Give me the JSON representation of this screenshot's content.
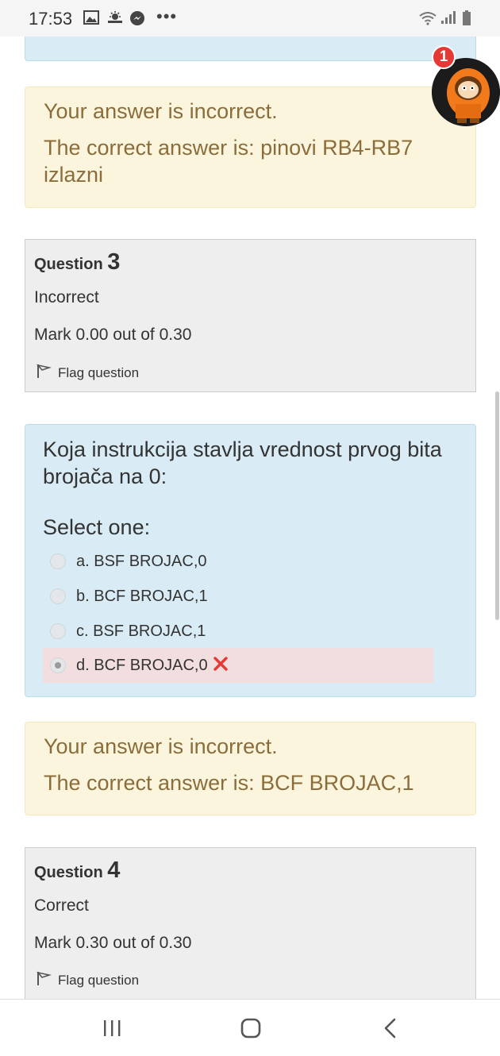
{
  "status_bar": {
    "time": "17:53",
    "icons": [
      "image-icon",
      "weather-icon",
      "messenger-icon",
      "more-dots-icon",
      "wifi-icon",
      "signal-icon",
      "battery-icon"
    ],
    "more_label": "•••"
  },
  "chat_head": {
    "badge_count": "1"
  },
  "feedback_1": {
    "line1": "Your answer is incorrect.",
    "line2": "The correct answer is: pinovi RB4-RB7",
    "line3": "izlazni"
  },
  "question_3": {
    "label": "Question",
    "number": "3",
    "state": "Incorrect",
    "mark": "Mark 0.00 out of 0.30",
    "flag": "Flag question",
    "text": "Koja instrukcija stavlja vrednost prvog bita brojača na 0:",
    "prompt": "Select one:",
    "options": [
      {
        "label": "a. BSF BROJAC,0",
        "selected": false
      },
      {
        "label": "b. BCF BROJAC,1",
        "selected": false
      },
      {
        "label": "c. BSF BROJAC,1",
        "selected": false
      },
      {
        "label": "d. BCF BROJAC,0",
        "selected": true,
        "incorrect": true
      }
    ]
  },
  "feedback_2": {
    "line1": "Your answer is incorrect.",
    "line2": "The correct answer is: BCF BROJAC,1"
  },
  "question_4": {
    "label": "Question",
    "number": "4",
    "state": "Correct",
    "mark": "Mark 0.30 out of 0.30",
    "flag": "Flag question"
  },
  "nav": {
    "icons": [
      "recent-apps-icon",
      "home-icon",
      "back-icon"
    ]
  },
  "colors": {
    "info_bg": "#d9ecf5",
    "feedback_bg": "#fcf5dd",
    "feedback_text": "#8a6d3b",
    "meta_bg": "#eeeeee",
    "incorrect_bg": "#f2dede",
    "incorrect_mark": "#e53935"
  }
}
